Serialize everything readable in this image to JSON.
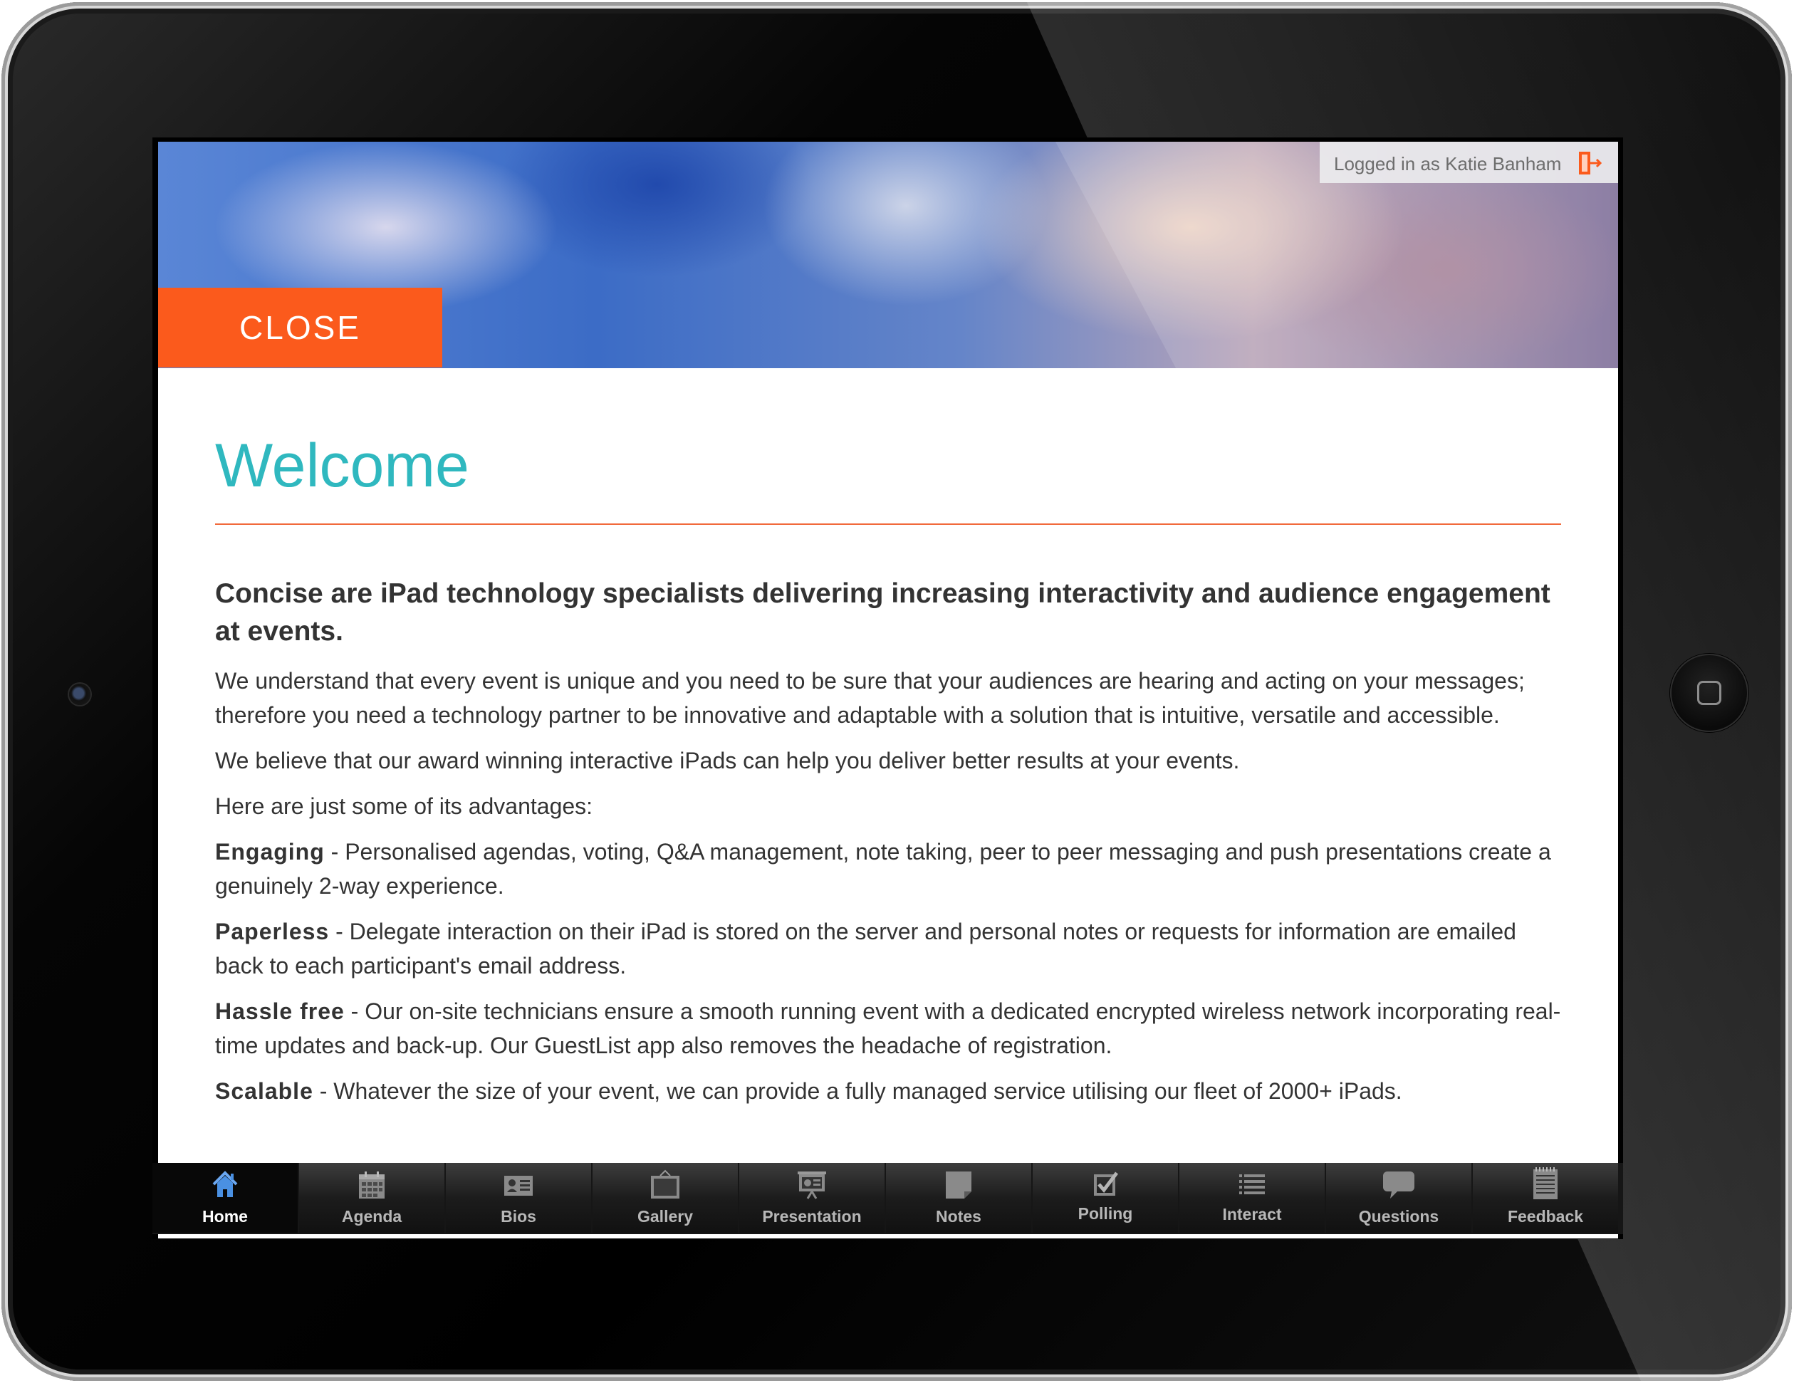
{
  "header": {
    "login_text": "Logged in as Katie Banham",
    "close_label": "CLOSE"
  },
  "content": {
    "title": "Welcome",
    "lead": "Concise are iPad technology specialists delivering increasing interactivity and audience engagement at events.",
    "paragraphs": [
      "We understand that every event is unique and you need to be sure that your audiences are hearing and acting on your messages; therefore you need a technology partner to be innovative and adaptable with a solution that is intuitive, versatile and accessible.",
      "We believe that our award winning interactive iPads can help you deliver better results at your events.",
      "Here are just some of its advantages:"
    ],
    "advantages": [
      {
        "term": "Engaging",
        "text": " - Personalised agendas, voting, Q&A management, note taking, peer to peer messaging and push presentations create a genuinely 2-way experience."
      },
      {
        "term": "Paperless",
        "text": " - Delegate interaction on their iPad is stored on the server and personal notes or requests for information are emailed back to each participant's email address."
      },
      {
        "term": "Hassle free",
        "text": " - Our on-site technicians ensure a smooth running event with a dedicated encrypted wireless network incorporating real-time updates and back-up. Our GuestList app also removes the headache of registration."
      },
      {
        "term": "Scalable",
        "text": " - Whatever the size of your event, we can provide a fully managed service utilising our fleet of 2000+ iPads."
      }
    ]
  },
  "tabs": [
    {
      "label": "Home",
      "icon": "home-icon",
      "active": true
    },
    {
      "label": "Agenda",
      "icon": "calendar-icon",
      "active": false
    },
    {
      "label": "Bios",
      "icon": "profile-card-icon",
      "active": false
    },
    {
      "label": "Gallery",
      "icon": "gallery-icon",
      "active": false
    },
    {
      "label": "Presentation",
      "icon": "presentation-icon",
      "active": false
    },
    {
      "label": "Notes",
      "icon": "notes-icon",
      "active": false
    },
    {
      "label": "Polling",
      "icon": "checkbox-icon",
      "active": false
    },
    {
      "label": "Interact",
      "icon": "list-icon",
      "active": false
    },
    {
      "label": "Questions",
      "icon": "speech-bubble-icon",
      "active": false
    },
    {
      "label": "Feedback",
      "icon": "notepad-icon",
      "active": false
    }
  ],
  "colors": {
    "accent_orange": "#fb5a1c",
    "title_teal": "#2fb8bf",
    "tab_active_icon": "#4a90e2"
  }
}
